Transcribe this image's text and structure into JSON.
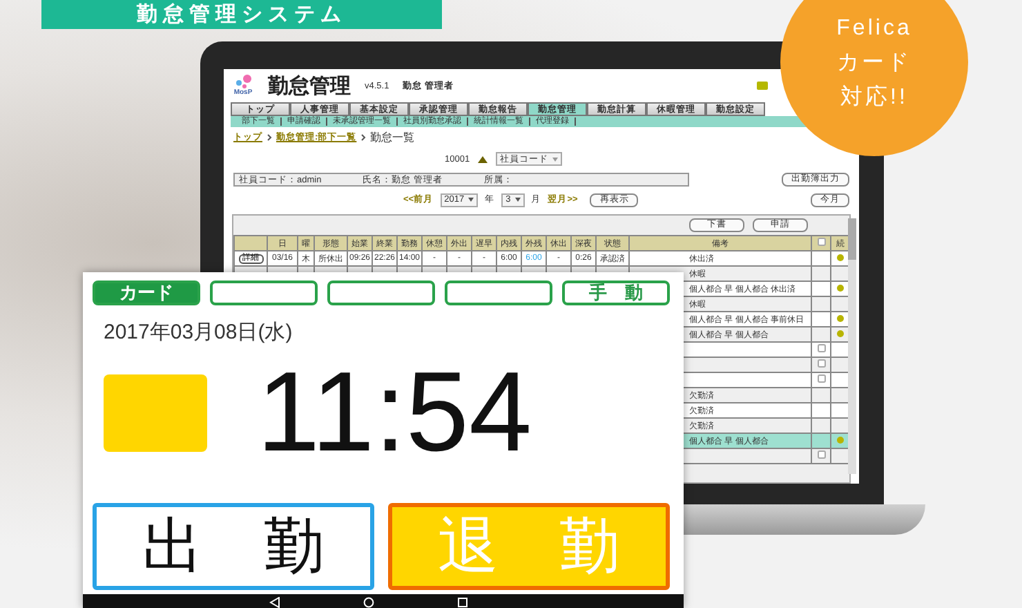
{
  "banner": {
    "title": "勤怠管理システム"
  },
  "badge": {
    "lines": [
      "Felica",
      "カード",
      "対応!!"
    ]
  },
  "laptop": {
    "logo": "MosP",
    "title": "勤怠管理",
    "version": "v4.5.1",
    "user": "勤怠 管理者",
    "tabs": [
      {
        "label": "トップ",
        "selected": false
      },
      {
        "label": "人事管理",
        "selected": false
      },
      {
        "label": "基本設定",
        "selected": false
      },
      {
        "label": "承認管理",
        "selected": false
      },
      {
        "label": "勤怠報告",
        "selected": false
      },
      {
        "label": "勤怠管理",
        "selected": true
      },
      {
        "label": "勤怠計算",
        "selected": false
      },
      {
        "label": "休暇管理",
        "selected": false
      },
      {
        "label": "勤怠設定",
        "selected": false
      }
    ],
    "submenu": [
      "部下一覧",
      "申請確認",
      "未承認管理一覧",
      "社員別勤怠承認",
      "統計情報一覧",
      "代理登録"
    ],
    "breadcrumb": [
      "トップ",
      "勤怠管理:部下一覧",
      "勤怠一覧"
    ],
    "sort": {
      "value": "10001",
      "field": "社員コード"
    },
    "info": [
      "社員コード：admin",
      "氏名：勤怠 管理者",
      "所属："
    ],
    "export_button": "出勤簿出力",
    "nav": {
      "prev": "<<前月",
      "year": "2017",
      "year_unit": "年",
      "month": "3",
      "month_unit": "月",
      "next": "翌月>>",
      "refresh": "再表示",
      "current": "今月"
    },
    "actions": [
      "下書",
      "申請"
    ],
    "columns": [
      {
        "kind": "blank"
      },
      {
        "kind": "text",
        "label": "日"
      },
      {
        "kind": "text",
        "label": "曜"
      },
      {
        "kind": "text",
        "label": "形態"
      },
      {
        "kind": "text",
        "label": "始業"
      },
      {
        "kind": "text",
        "label": "終業"
      },
      {
        "kind": "text",
        "label": "勤務"
      },
      {
        "kind": "text",
        "label": "休憩"
      },
      {
        "kind": "text",
        "label": "外出"
      },
      {
        "kind": "text",
        "label": "遅早"
      },
      {
        "kind": "text",
        "label": "内残"
      },
      {
        "kind": "text",
        "label": "外残"
      },
      {
        "kind": "text",
        "label": "休出"
      },
      {
        "kind": "text",
        "label": "深夜"
      },
      {
        "kind": "text",
        "label": "状態"
      },
      {
        "kind": "text",
        "label": "備考"
      },
      {
        "kind": "checkbox"
      },
      {
        "kind": "text",
        "label": "続"
      }
    ],
    "rows": [
      {
        "cells": [
          "詳細",
          "03/16",
          "木",
          "所休出",
          "09:26",
          "22:26",
          "14:00",
          "-",
          "-",
          "-",
          "6:00",
          "6:00",
          "-",
          "0:26",
          "承認済"
        ],
        "remark": "休出済",
        "checkbox": false,
        "confirmed": true,
        "selected": false
      },
      {
        "remark": "休暇",
        "checkbox": false,
        "confirmed": false,
        "selected": false
      },
      {
        "remark": "個人都合 早 個人都合 休出済",
        "checkbox": false,
        "confirmed": true,
        "selected": false
      },
      {
        "remark": "休暇",
        "checkbox": false,
        "confirmed": false,
        "selected": false
      },
      {
        "remark": "個人都合 早 個人都合 事前休日",
        "checkbox": false,
        "confirmed": true,
        "selected": false
      },
      {
        "remark": "個人都合 早 個人都合",
        "checkbox": false,
        "confirmed": true,
        "selected": false
      },
      {
        "checkbox": true,
        "confirmed": false,
        "selected": false
      },
      {
        "checkbox": true,
        "confirmed": false,
        "selected": false
      },
      {
        "checkbox": true,
        "confirmed": false,
        "selected": false
      },
      {
        "remark": "欠勤済",
        "checkbox": false,
        "confirmed": false,
        "selected": false
      },
      {
        "remark": "欠勤済",
        "checkbox": false,
        "confirmed": false,
        "selected": false
      },
      {
        "remark": "欠勤済",
        "checkbox": false,
        "confirmed": false,
        "selected": false
      },
      {
        "remark": "個人都合 早 個人都合",
        "checkbox": false,
        "confirmed": true,
        "selected": true
      },
      {
        "checkbox": true,
        "confirmed": false,
        "selected": false
      }
    ]
  },
  "tablet": {
    "modes": [
      {
        "label": "カード",
        "selected": true
      },
      {
        "selected": false
      },
      {
        "selected": false
      },
      {
        "selected": false
      },
      {
        "label": "手　動",
        "selected": false
      }
    ],
    "date": "2017年03月08日(水)",
    "time": "11:54",
    "buttons": [
      {
        "kind": "arrive",
        "label": "出　勤"
      },
      {
        "kind": "leave",
        "label": "退　勤"
      }
    ]
  }
}
